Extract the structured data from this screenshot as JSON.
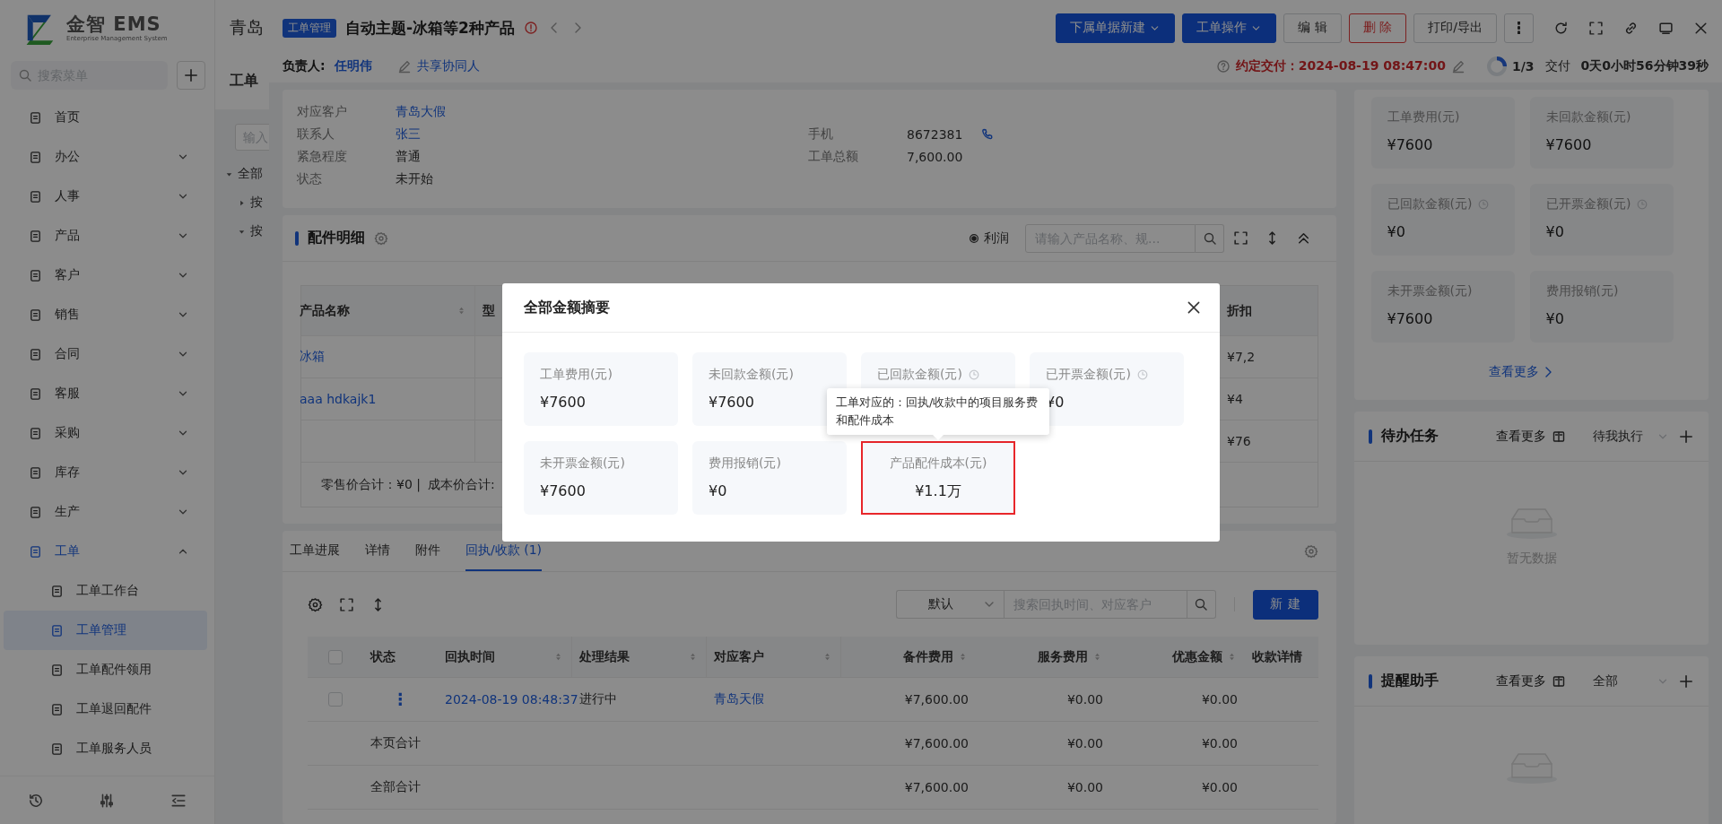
{
  "sidebar": {
    "logo_title": "金智 EMS",
    "logo_subtitle": "Enterprise Management System",
    "search": {
      "placeholder": "搜索菜单"
    },
    "items": [
      {
        "label": "首页",
        "kind": "link",
        "selected": false
      },
      {
        "label": "办公",
        "kind": "group",
        "expanded": false,
        "selected": false
      },
      {
        "label": "人事",
        "kind": "group",
        "expanded": false,
        "selected": false
      },
      {
        "label": "产品",
        "kind": "group",
        "expanded": false,
        "selected": false
      },
      {
        "label": "客户",
        "kind": "group",
        "expanded": false,
        "selected": false
      },
      {
        "label": "销售",
        "kind": "group",
        "expanded": false,
        "selected": false
      },
      {
        "label": "合同",
        "kind": "group",
        "expanded": false,
        "selected": false
      },
      {
        "label": "客服",
        "kind": "group",
        "expanded": false,
        "selected": false
      },
      {
        "label": "采购",
        "kind": "group",
        "expanded": false,
        "selected": false
      },
      {
        "label": "库存",
        "kind": "group",
        "expanded": false,
        "selected": false
      },
      {
        "label": "生产",
        "kind": "group",
        "expanded": false,
        "selected": false
      },
      {
        "label": "工单",
        "kind": "group",
        "expanded": true,
        "selected": true,
        "children": [
          {
            "label": "工单工作台",
            "selected": false
          },
          {
            "label": "工单管理",
            "selected": true
          },
          {
            "label": "工单配件领用",
            "selected": false
          },
          {
            "label": "工单退回配件",
            "selected": false
          },
          {
            "label": "工单服务人员",
            "selected": false
          }
        ]
      }
    ]
  },
  "background_page": {
    "title": "青岛",
    "heading": "工单",
    "filter": {
      "placeholder": "输入"
    },
    "tree": [
      {
        "label": "全部",
        "expanded": true,
        "children": [
          {
            "label": "按",
            "expanded": false
          },
          {
            "label": "按",
            "expanded": true
          }
        ]
      }
    ]
  },
  "drawer": {
    "tag": "工单管理",
    "title": "自动主题-冰箱等2种产品",
    "buttons": [
      {
        "label": "下属单据新建",
        "kind": "primary",
        "dropdown": true
      },
      {
        "label": "工单操作",
        "kind": "primary",
        "dropdown": true
      },
      {
        "label": "编 辑",
        "kind": "default",
        "dropdown": false
      },
      {
        "label": "删 除",
        "kind": "danger",
        "dropdown": false
      },
      {
        "label": "打印/导出",
        "kind": "default",
        "dropdown": false
      }
    ],
    "owner_label": "负责人:",
    "owner": "任明伟",
    "share": "共享协同人",
    "due": "约定交付：2024-08-19 08:47:00",
    "progress": {
      "level": 0.25,
      "text": "1/3"
    },
    "stage": "交付",
    "elapsed": "0天0小时56分钟39秒"
  },
  "info": {
    "rows": [
      {
        "cells": [
          {
            "label": "对应客户",
            "value": "青岛大假",
            "kind": "link"
          }
        ]
      },
      {
        "cells": [
          {
            "label": "联系人",
            "value": "张三",
            "kind": "link"
          },
          {
            "label": "手机",
            "value": "8672381",
            "kind": "phone"
          }
        ]
      },
      {
        "cells": [
          {
            "label": "紧急程度",
            "value": "普通",
            "kind": "text"
          },
          {
            "label": "工单总额",
            "value": "7,600.00",
            "kind": "text"
          }
        ]
      },
      {
        "cells": [
          {
            "label": "状态",
            "value": "未开始",
            "kind": "text"
          }
        ]
      }
    ]
  },
  "parts": {
    "title": "配件明细",
    "option": {
      "label": "利润",
      "checked": true
    },
    "search": {
      "placeholder": "请输入产品名称、规..."
    },
    "columns": [
      "产品名称",
      "型",
      "折扣"
    ],
    "rows": [
      {
        "name": "冰箱",
        "discount": "¥7,2"
      },
      {
        "name": "aaa hdkajk1",
        "discount": "¥4"
      },
      {
        "discount": "¥76"
      }
    ],
    "footer": [
      "零售价合计：¥0 |",
      "成本价合计:"
    ]
  },
  "records": {
    "tabs": [
      {
        "label": "工单进展",
        "selected": false
      },
      {
        "label": "详情",
        "selected": false
      },
      {
        "label": "附件",
        "selected": false
      },
      {
        "label": "回执/收款 (1)",
        "selected": true
      }
    ],
    "select": "默认",
    "search": {
      "placeholder": "搜索回执时间、对应客户"
    },
    "new_button": "新 建",
    "all_checked": false,
    "columns": [
      {
        "label": "状态",
        "sortable": false,
        "kind": "text"
      },
      {
        "label": "回执时间",
        "sortable": true,
        "kind": "link"
      },
      {
        "label": "处理结果",
        "sortable": true,
        "kind": "text"
      },
      {
        "label": "对应客户",
        "sortable": true,
        "kind": "link"
      },
      {
        "label": "备件费用",
        "sortable": true,
        "kind": "money"
      },
      {
        "label": "服务费用",
        "sortable": true,
        "kind": "money"
      },
      {
        "label": "优惠金额",
        "sortable": true,
        "kind": "money"
      },
      {
        "label": "收款详情",
        "sortable": false,
        "kind": "text"
      }
    ],
    "rows": [
      {
        "kind": "data",
        "checked": false,
        "cells": [
          "⋮",
          "2024-08-19 08:48:37",
          "进行中",
          "青岛天假",
          "¥7,600.00",
          "¥0.00",
          "¥0.00"
        ]
      },
      {
        "kind": "total",
        "cells": [
          "本页合计",
          "",
          "",
          "",
          "¥7,600.00",
          "¥0.00",
          "¥0.00"
        ]
      },
      {
        "kind": "total",
        "cells": [
          "全部合计",
          "",
          "",
          "",
          "¥7,600.00",
          "¥0.00",
          "¥0.00"
        ]
      }
    ]
  },
  "summary": {
    "cards": [
      {
        "label": "工单费用(元)",
        "value": "¥7600",
        "clock": false
      },
      {
        "label": "未回款金额(元)",
        "value": "¥7600",
        "clock": false
      },
      {
        "label": "已回款金额(元)",
        "value": "¥0",
        "clock": true
      },
      {
        "label": "已开票金额(元)",
        "value": "¥0",
        "clock": true
      },
      {
        "label": "未开票金额(元)",
        "value": "¥7600",
        "clock": false
      },
      {
        "label": "费用报销(元)",
        "value": "¥0",
        "clock": false
      }
    ],
    "more": "查看更多"
  },
  "tasks": [
    {
      "title": "待办任务",
      "more": "查看更多",
      "filter": "待我执行",
      "empty": "暂无数据"
    },
    {
      "title": "提醒助手",
      "more": "查看更多",
      "filter": "全部"
    }
  ],
  "modal": {
    "title": "全部金额摘要",
    "cards": [
      {
        "label": "工单费用(元)",
        "value": "¥7600",
        "clock": false,
        "highlighted": false
      },
      {
        "label": "未回款金额(元)",
        "value": "¥7600",
        "clock": false,
        "highlighted": false
      },
      {
        "label": "已回款金额(元)",
        "clock": true,
        "highlighted": false
      },
      {
        "label": "已开票金额(元)",
        "value": "¥0",
        "clock": true,
        "highlighted": false
      },
      {
        "label": "未开票金额(元)",
        "value": "¥7600",
        "clock": false,
        "highlighted": false
      },
      {
        "label": "费用报销(元)",
        "value": "¥0",
        "clock": false,
        "highlighted": false
      },
      {
        "label": "产品配件成本(元)",
        "value": "¥1.1万",
        "clock": false,
        "highlighted": true,
        "tooltip": "工单对应的：回执/收款中的项目服务费和配件成本"
      }
    ]
  }
}
